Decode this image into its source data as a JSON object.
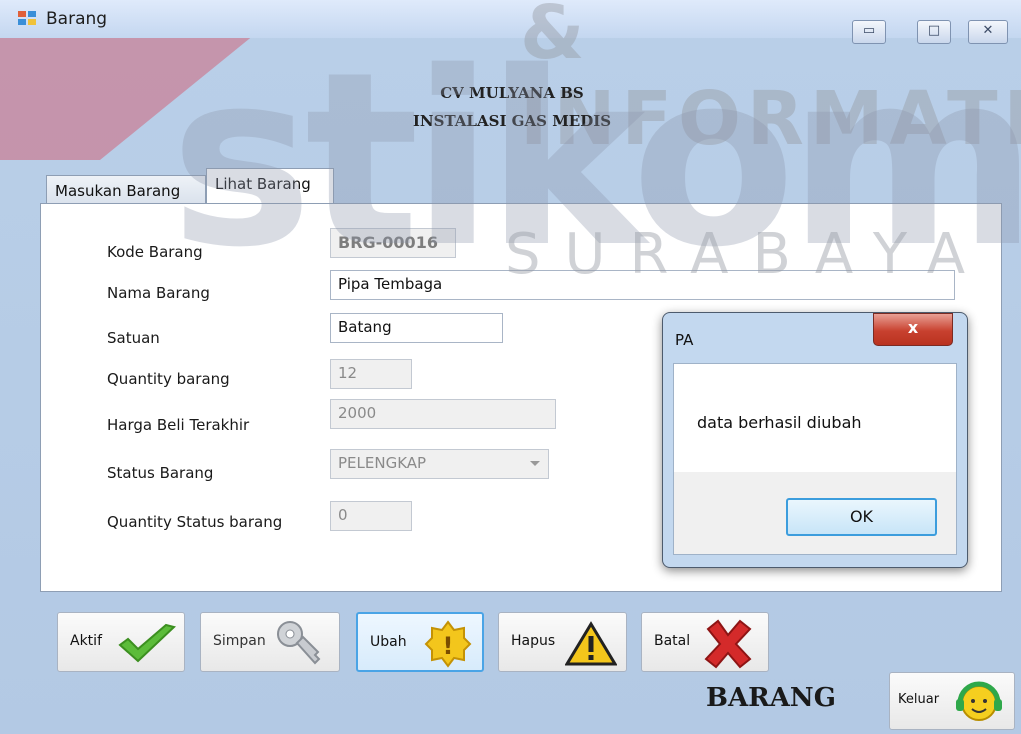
{
  "window": {
    "title": "Barang",
    "controls": [
      "minimize-icon",
      "maximize-icon",
      "close-icon"
    ]
  },
  "watermark": {
    "top": "& INFORMATIKA",
    "main": "stikom",
    "sub": "SURABAYA"
  },
  "header": {
    "line1": "CV MULYANA BS",
    "line2": "INSTALASI GAS MEDIS"
  },
  "tabs": [
    {
      "label": "Masukan Barang",
      "active": false
    },
    {
      "label": "Lihat Barang",
      "active": true
    }
  ],
  "form": {
    "kode_label": "Kode Barang",
    "kode_value": "BRG-00016",
    "nama_label": "Nama Barang",
    "nama_value": "Pipa Tembaga",
    "satuan_label": "Satuan",
    "satuan_value": "Batang",
    "qty_label": "Quantity barang",
    "qty_value": "12",
    "harga_label": "Harga Beli Terakhir",
    "harga_value": "2000",
    "status_label": "Status Barang",
    "status_value": "PELENGKAP",
    "qty_status_label": "Quantity Status barang",
    "qty_status_value": "0"
  },
  "buttons": {
    "aktif": "Aktif",
    "simpan": "Simpan",
    "ubah": "Ubah",
    "hapus": "Hapus",
    "batal": "Batal",
    "keluar": "Keluar"
  },
  "footer_title": "BARANG",
  "dialog": {
    "title": "PA",
    "message": "data berhasil diubah",
    "ok": "OK",
    "close_glyph": "x"
  },
  "colors": {
    "window_bg": "#b3c9e4",
    "focus_border": "#4aa4e6",
    "close_red": "#c8412f"
  }
}
